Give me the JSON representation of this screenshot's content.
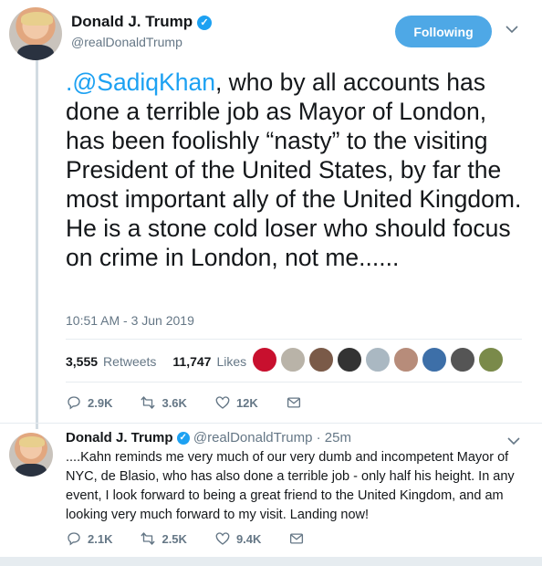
{
  "main_tweet": {
    "author_name": "Donald J. Trump",
    "author_handle": "@realDonaldTrump",
    "follow_button": "Following",
    "mention": ".@SadiqKhan",
    "body": ", who by all accounts has done a terrible job as Mayor of London, has been foolishly “nasty” to the visiting President of the United States, by far the most important ally of the United Kingdom. He is a stone cold loser who should focus on crime in London, not me......",
    "timestamp": "10:51 AM - 3 Jun 2019",
    "retweets_count": "3,555",
    "retweets_label": "Retweets",
    "likes_count": "11,747",
    "likes_label": "Likes",
    "actions": {
      "replies": "2.9K",
      "retweets": "3.6K",
      "likes": "12K"
    }
  },
  "reply_tweet": {
    "author_name": "Donald J. Trump",
    "author_handle": "@realDonaldTrump",
    "age": "· 25m",
    "body": "....Kahn reminds me very much of our very dumb and incompetent Mayor of NYC, de Blasio, who has also done a terrible job - only half his height. In any event, I look forward to being a great friend to the United Kingdom, and am looking very much forward to my visit. Landing now!",
    "actions": {
      "replies": "2.1K",
      "retweets": "2.5K",
      "likes": "9.4K"
    }
  },
  "icons": [
    "verified-badge-icon",
    "chevron-down-icon",
    "reply-icon",
    "retweet-icon",
    "like-icon",
    "message-icon"
  ],
  "colors": {
    "accent": "#1da1f2",
    "follow_button": "#4ea8e6",
    "secondary_text": "#657786"
  },
  "liker_avatars": [
    {
      "color": "#c8102e"
    },
    {
      "color": "#b9b3a8"
    },
    {
      "color": "#7a5a48"
    },
    {
      "color": "#333333"
    },
    {
      "color": "#aab8c2"
    },
    {
      "color": "#b78c7a"
    },
    {
      "color": "#3d6fa8"
    },
    {
      "color": "#555555"
    },
    {
      "color": "#7a8a4a"
    }
  ]
}
